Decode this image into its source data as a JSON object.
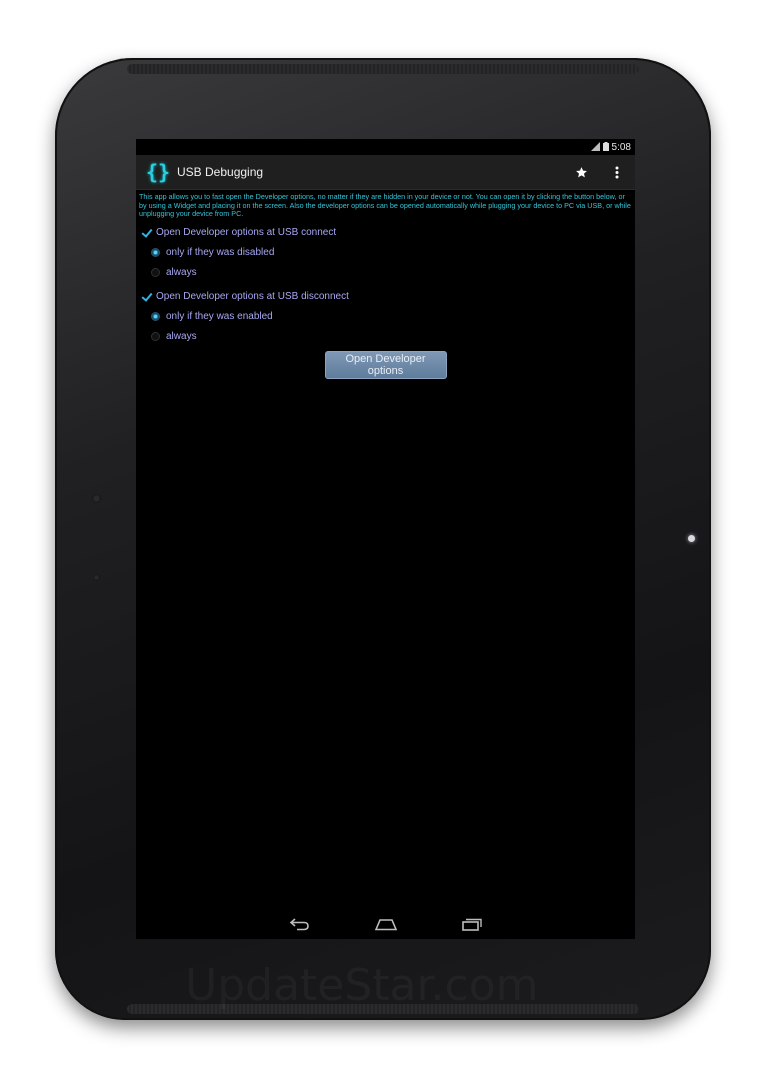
{
  "status_bar": {
    "time": "5:08"
  },
  "action_bar": {
    "title": "USB Debugging",
    "logo_glyph": "{}",
    "icons": [
      "star-icon",
      "overflow-menu-icon"
    ]
  },
  "description": "This app allows you to fast open the Developer options, no matter if they are hidden in your device or not. You can open it by clicking the button below, or by using a Widget and placing it on the screen. Also the developer options can be opened automatically while plugging your device to PC via USB, or while unplugging your device from PC.",
  "connect_section": {
    "checkbox_label": "Open Developer options at USB connect",
    "checked": true,
    "options": [
      {
        "label": "only if they was disabled",
        "selected": true
      },
      {
        "label": "always",
        "selected": false
      }
    ]
  },
  "disconnect_section": {
    "checkbox_label": "Open Developer options at USB disconnect",
    "checked": true,
    "options": [
      {
        "label": "only if they was enabled",
        "selected": true
      },
      {
        "label": "always",
        "selected": false
      }
    ]
  },
  "open_button_label": "Open Developer options",
  "nav_bar": {
    "icons": [
      "back-icon",
      "home-icon",
      "recent-apps-icon"
    ]
  },
  "watermark": "UpdateStar.com",
  "colors": {
    "accent": "#35c4d8",
    "option_text": "#a7a7f2",
    "button": "#6f89a8",
    "background": "#000000"
  }
}
